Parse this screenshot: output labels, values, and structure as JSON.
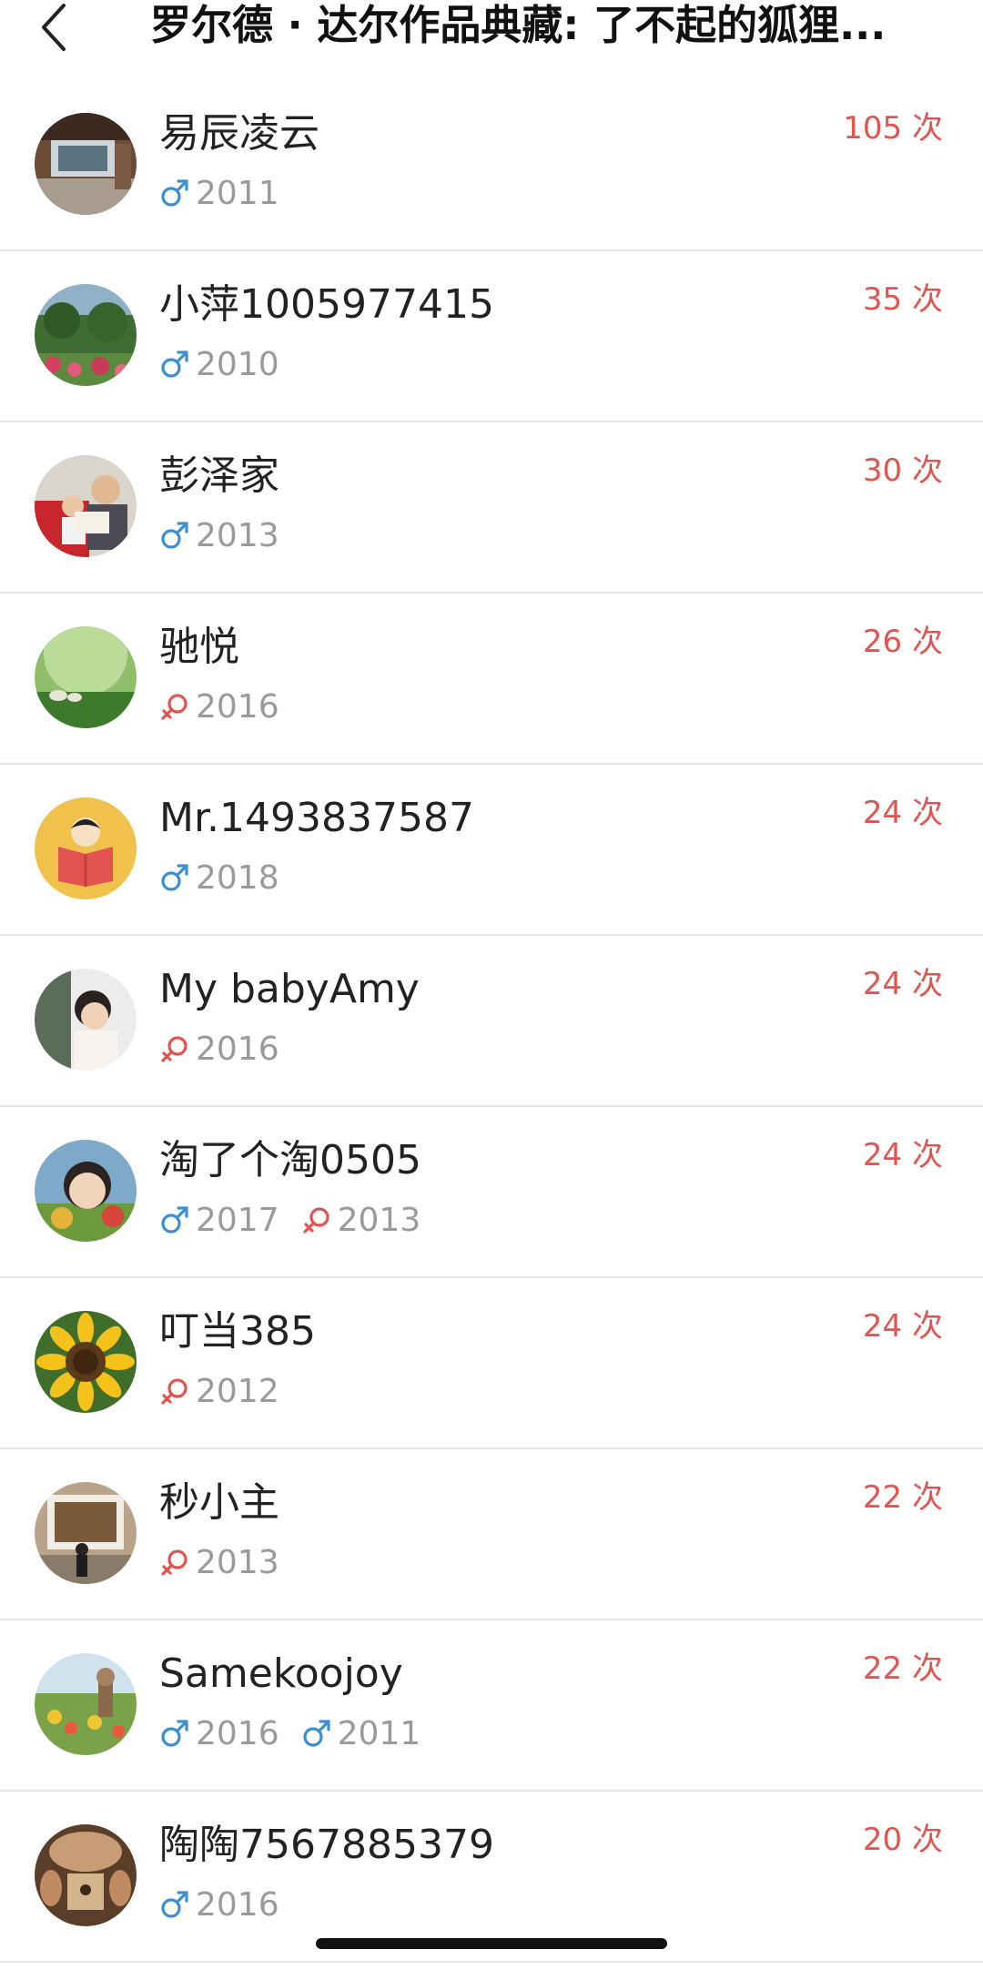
{
  "header": {
    "back_icon": "chevron-left-icon",
    "title": "罗尔德 · 达尔作品典藏: 了不起的狐狸..."
  },
  "colors": {
    "male": "#3a8fd4",
    "female": "#e2544f",
    "count": "#e2544f",
    "meta_text": "#9a9a9a"
  },
  "readers": [
    {
      "name": "易辰凌云",
      "count": "105 次",
      "children": [
        {
          "gender": "male",
          "year": "2011"
        }
      ]
    },
    {
      "name": "小萍1005977415",
      "count": "35 次",
      "children": [
        {
          "gender": "male",
          "year": "2010"
        }
      ]
    },
    {
      "name": "彭泽家",
      "count": "30 次",
      "children": [
        {
          "gender": "male",
          "year": "2013"
        }
      ]
    },
    {
      "name": "驰悦",
      "count": "26 次",
      "children": [
        {
          "gender": "female",
          "year": "2016"
        }
      ]
    },
    {
      "name": "Mr.1493837587",
      "count": "24 次",
      "children": [
        {
          "gender": "male",
          "year": "2018"
        }
      ]
    },
    {
      "name": "My babyAmy",
      "count": "24 次",
      "children": [
        {
          "gender": "female",
          "year": "2016"
        }
      ]
    },
    {
      "name": "淘了个淘0505",
      "count": "24 次",
      "children": [
        {
          "gender": "male",
          "year": "2017"
        },
        {
          "gender": "female",
          "year": "2013"
        }
      ]
    },
    {
      "name": "叮当385",
      "count": "24 次",
      "children": [
        {
          "gender": "female",
          "year": "2012"
        }
      ]
    },
    {
      "name": "秒小主",
      "count": "22 次",
      "children": [
        {
          "gender": "female",
          "year": "2013"
        }
      ]
    },
    {
      "name": "Samekoojoy",
      "count": "22 次",
      "children": [
        {
          "gender": "male",
          "year": "2016"
        },
        {
          "gender": "male",
          "year": "2011"
        }
      ]
    },
    {
      "name": "陶陶7567885379",
      "count": "20 次",
      "children": [
        {
          "gender": "male",
          "year": "2016"
        }
      ]
    }
  ]
}
